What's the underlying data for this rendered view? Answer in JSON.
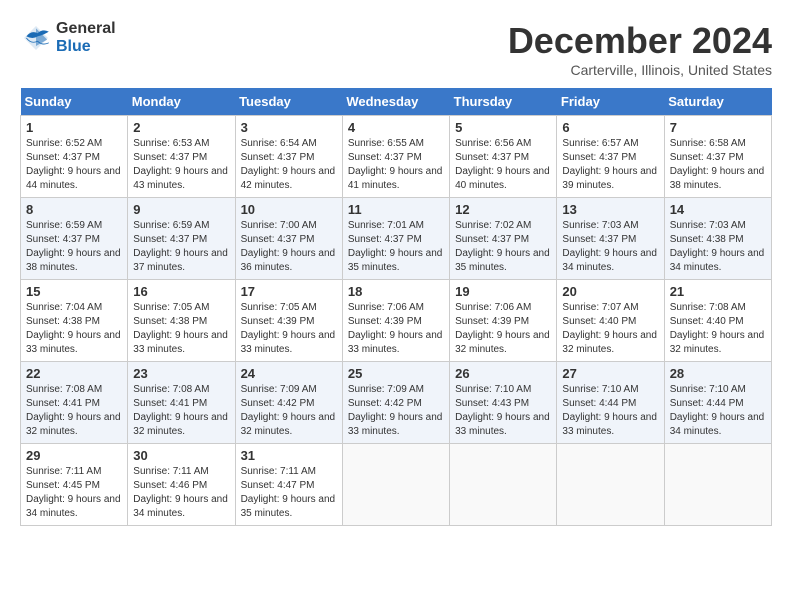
{
  "header": {
    "logo_general": "General",
    "logo_blue": "Blue",
    "month_title": "December 2024",
    "location": "Carterville, Illinois, United States"
  },
  "weekdays": [
    "Sunday",
    "Monday",
    "Tuesday",
    "Wednesday",
    "Thursday",
    "Friday",
    "Saturday"
  ],
  "weeks": [
    [
      {
        "day": "1",
        "sunrise": "6:52 AM",
        "sunset": "4:37 PM",
        "daylight": "9 hours and 44 minutes."
      },
      {
        "day": "2",
        "sunrise": "6:53 AM",
        "sunset": "4:37 PM",
        "daylight": "9 hours and 43 minutes."
      },
      {
        "day": "3",
        "sunrise": "6:54 AM",
        "sunset": "4:37 PM",
        "daylight": "9 hours and 42 minutes."
      },
      {
        "day": "4",
        "sunrise": "6:55 AM",
        "sunset": "4:37 PM",
        "daylight": "9 hours and 41 minutes."
      },
      {
        "day": "5",
        "sunrise": "6:56 AM",
        "sunset": "4:37 PM",
        "daylight": "9 hours and 40 minutes."
      },
      {
        "day": "6",
        "sunrise": "6:57 AM",
        "sunset": "4:37 PM",
        "daylight": "9 hours and 39 minutes."
      },
      {
        "day": "7",
        "sunrise": "6:58 AM",
        "sunset": "4:37 PM",
        "daylight": "9 hours and 38 minutes."
      }
    ],
    [
      {
        "day": "8",
        "sunrise": "6:59 AM",
        "sunset": "4:37 PM",
        "daylight": "9 hours and 38 minutes."
      },
      {
        "day": "9",
        "sunrise": "6:59 AM",
        "sunset": "4:37 PM",
        "daylight": "9 hours and 37 minutes."
      },
      {
        "day": "10",
        "sunrise": "7:00 AM",
        "sunset": "4:37 PM",
        "daylight": "9 hours and 36 minutes."
      },
      {
        "day": "11",
        "sunrise": "7:01 AM",
        "sunset": "4:37 PM",
        "daylight": "9 hours and 35 minutes."
      },
      {
        "day": "12",
        "sunrise": "7:02 AM",
        "sunset": "4:37 PM",
        "daylight": "9 hours and 35 minutes."
      },
      {
        "day": "13",
        "sunrise": "7:03 AM",
        "sunset": "4:37 PM",
        "daylight": "9 hours and 34 minutes."
      },
      {
        "day": "14",
        "sunrise": "7:03 AM",
        "sunset": "4:38 PM",
        "daylight": "9 hours and 34 minutes."
      }
    ],
    [
      {
        "day": "15",
        "sunrise": "7:04 AM",
        "sunset": "4:38 PM",
        "daylight": "9 hours and 33 minutes."
      },
      {
        "day": "16",
        "sunrise": "7:05 AM",
        "sunset": "4:38 PM",
        "daylight": "9 hours and 33 minutes."
      },
      {
        "day": "17",
        "sunrise": "7:05 AM",
        "sunset": "4:39 PM",
        "daylight": "9 hours and 33 minutes."
      },
      {
        "day": "18",
        "sunrise": "7:06 AM",
        "sunset": "4:39 PM",
        "daylight": "9 hours and 33 minutes."
      },
      {
        "day": "19",
        "sunrise": "7:06 AM",
        "sunset": "4:39 PM",
        "daylight": "9 hours and 32 minutes."
      },
      {
        "day": "20",
        "sunrise": "7:07 AM",
        "sunset": "4:40 PM",
        "daylight": "9 hours and 32 minutes."
      },
      {
        "day": "21",
        "sunrise": "7:08 AM",
        "sunset": "4:40 PM",
        "daylight": "9 hours and 32 minutes."
      }
    ],
    [
      {
        "day": "22",
        "sunrise": "7:08 AM",
        "sunset": "4:41 PM",
        "daylight": "9 hours and 32 minutes."
      },
      {
        "day": "23",
        "sunrise": "7:08 AM",
        "sunset": "4:41 PM",
        "daylight": "9 hours and 32 minutes."
      },
      {
        "day": "24",
        "sunrise": "7:09 AM",
        "sunset": "4:42 PM",
        "daylight": "9 hours and 32 minutes."
      },
      {
        "day": "25",
        "sunrise": "7:09 AM",
        "sunset": "4:42 PM",
        "daylight": "9 hours and 33 minutes."
      },
      {
        "day": "26",
        "sunrise": "7:10 AM",
        "sunset": "4:43 PM",
        "daylight": "9 hours and 33 minutes."
      },
      {
        "day": "27",
        "sunrise": "7:10 AM",
        "sunset": "4:44 PM",
        "daylight": "9 hours and 33 minutes."
      },
      {
        "day": "28",
        "sunrise": "7:10 AM",
        "sunset": "4:44 PM",
        "daylight": "9 hours and 34 minutes."
      }
    ],
    [
      {
        "day": "29",
        "sunrise": "7:11 AM",
        "sunset": "4:45 PM",
        "daylight": "9 hours and 34 minutes."
      },
      {
        "day": "30",
        "sunrise": "7:11 AM",
        "sunset": "4:46 PM",
        "daylight": "9 hours and 34 minutes."
      },
      {
        "day": "31",
        "sunrise": "7:11 AM",
        "sunset": "4:47 PM",
        "daylight": "9 hours and 35 minutes."
      },
      null,
      null,
      null,
      null
    ]
  ],
  "labels": {
    "sunrise": "Sunrise:",
    "sunset": "Sunset:",
    "daylight": "Daylight:"
  }
}
